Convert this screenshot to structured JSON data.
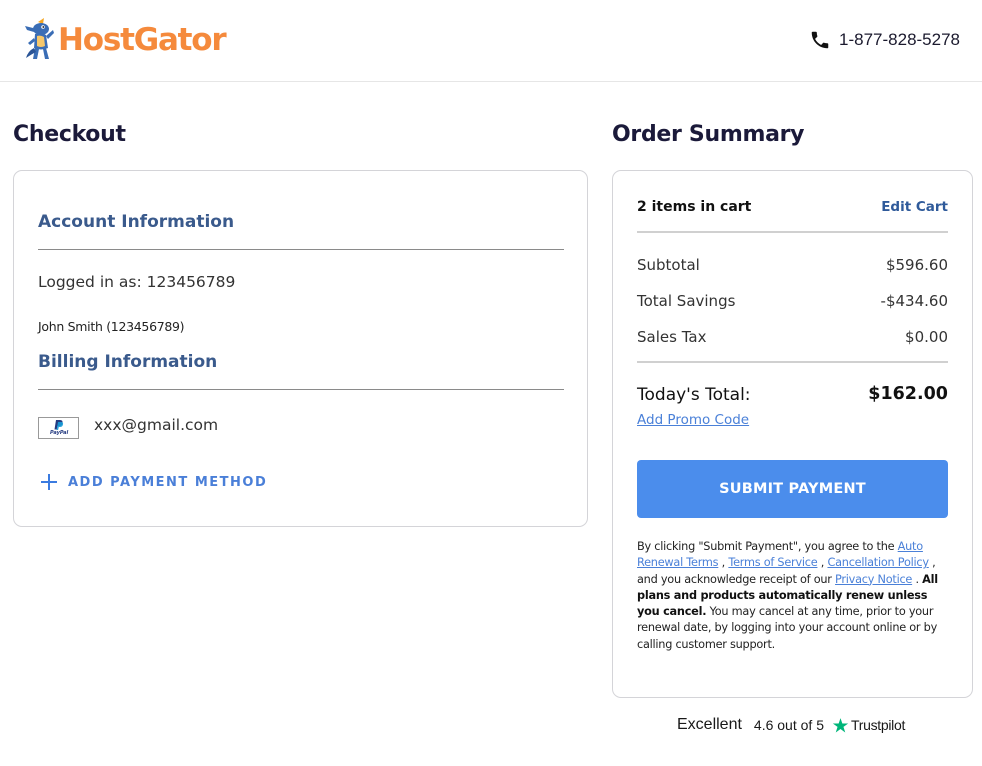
{
  "brand": {
    "name": "HostGator",
    "primary_color": "#f58a3c",
    "mascot_icon": "gator-mascot-icon"
  },
  "header": {
    "phone_icon": "phone-icon",
    "phone_number": "1-877-828-5278"
  },
  "checkout": {
    "title": "Checkout",
    "account": {
      "heading": "Account Information",
      "logged_in_label": "Logged in as:",
      "logged_in_id": "123456789",
      "user_line": "John Smith (123456789)"
    },
    "billing": {
      "heading": "Billing Information",
      "payment_method_icon": "paypal-icon",
      "payment_logo_text": "PayPal",
      "payment_email": "xxx@gmail.com",
      "add_payment_label": "ADD PAYMENT METHOD"
    }
  },
  "summary": {
    "title": "Order Summary",
    "cart_count": "2 items in cart",
    "edit_cart": "Edit Cart",
    "lines": [
      {
        "label": "Subtotal",
        "value": "$596.60"
      },
      {
        "label": "Total Savings",
        "value": "-$434.60"
      },
      {
        "label": "Sales Tax",
        "value": "$0.00"
      }
    ],
    "total_label": "Today's Total:",
    "total_value": "$162.00",
    "promo_link": "Add Promo Code",
    "submit_label": "SUBMIT PAYMENT",
    "button_color": "#4b8dec",
    "legal": {
      "prefix": "By clicking \"Submit Payment\", you agree to the",
      "auto_renewal": "Auto Renewal Terms",
      "sep1": ",",
      "terms": "Terms of Service",
      "sep2": ",",
      "cancellation": "Cancellation Policy",
      "acknowledge": ", and you acknowledge receipt of our",
      "privacy": "Privacy Notice",
      "period": ".",
      "bold_text": "All plans and products automatically renew unless you cancel.",
      "suffix": "You may cancel at any time, prior to your renewal date, by logging into your account online or by calling customer support."
    }
  },
  "trustpilot": {
    "rating_word": "Excellent",
    "rating_text": "4.6 out of 5",
    "star_icon": "trustpilot-star-icon",
    "brand": "Trustpilot",
    "star_color": "#00b67a"
  }
}
